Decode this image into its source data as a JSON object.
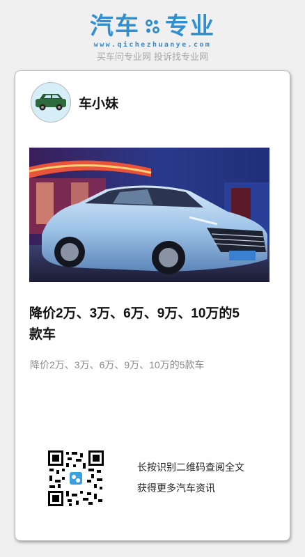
{
  "brand": {
    "title_left": "汽车",
    "title_right": "专业",
    "gear_icon": "gear-icon",
    "domain": "www.qichezhuanye.com",
    "slogan": "买车问专业网 投诉找专业网",
    "color": "#2f8fd0"
  },
  "author": {
    "name": "车小妹",
    "avatar_icon": "car-avatar-icon"
  },
  "article": {
    "hero_image": "car-photo",
    "title": "降价2万、3万、6万、9万、10万的5款车",
    "summary": "降价2万、3万、6万、9万、10万的5款车"
  },
  "qr": {
    "icon": "qr-code-icon",
    "line1": "长按识别二维码查阅全文",
    "line2": "获得更多汽车资讯"
  }
}
